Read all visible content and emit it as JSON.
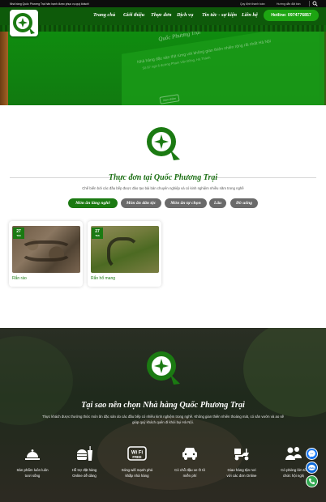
{
  "topbar": {
    "welcome": "Nhà hàng Quốc Phương Trại hân hạnh được phục vụ quý khách!",
    "links": [
      "Quy định thanh toán",
      "Hướng dẫn đặt bàn"
    ]
  },
  "nav": {
    "items": [
      "Trang chủ",
      "Giới thiệu",
      "Thực đơn",
      "Dịch vụ",
      "Tin tức - sự kiện",
      "Liên hệ"
    ],
    "hotline": "Hotline: 0974776857"
  },
  "hero": {
    "title": "Quốc Phương Trại",
    "text": "Nhà hàng đặc sản thịt rừng với không gian thiên nhiên rộng rãi nhất Hà Nội",
    "subtext": "Số 87 ngõ 6 đường Phạm Văn Đồng, Hà Thành",
    "button": "Xem thêm"
  },
  "menu_section": {
    "title": "Thực đơn tại Quốc Phương Trại",
    "description": "Chế biến bởi các đầu bếp được đào tạo bài bản chuyên nghiệp và có kinh nghiệm nhiều năm trong nghề",
    "tabs": [
      "Món ăn làng nghề",
      "Món ăn dân tộc",
      "Món ăn tự chọn",
      "Lẩu",
      "Đồ uống"
    ],
    "cards": [
      {
        "day": "27",
        "month": "Th6",
        "name": "Rắn ráo"
      },
      {
        "day": "27",
        "month": "Th6",
        "name": "Rắn hổ mang"
      }
    ]
  },
  "why_section": {
    "title": "Tại sao nên chọn Nhà hàng Quốc Phương Trại",
    "description_line1": "Thực khách được thưởng thức món ăn đặc sản do các đầu bếp có nhiều kinh nghiệm trong nghề. Không gian thiên nhiên thoáng mát, có sân vườn và ao sẽ",
    "description_line2": "giúp quý khách quên đi khói bụi Hà Nội.",
    "features": [
      {
        "icon": "chef-bell-icon",
        "line1": "Sản phẩm luôn luôn",
        "line2": "tươi sống"
      },
      {
        "icon": "burger-drink-icon",
        "line1": "Hỗ trợ đặt hàng",
        "line2": "Online dễ dàng"
      },
      {
        "icon": "wifi-free-icon",
        "line1": "Sóng wifi mạnh phủ",
        "line2": "khắp nhà hàng"
      },
      {
        "icon": "car-parking-icon",
        "line1": "Có chỗ đậu xe Ô tô",
        "line2": "miễn phí"
      },
      {
        "icon": "delivery-scooter-icon",
        "line1": "Giao hàng tận nơi",
        "line2": "với các đơn Online"
      },
      {
        "icon": "group-people-icon",
        "line1": "Có phòng lớn tổ",
        "line2": "chức hội nghị"
      }
    ]
  },
  "colors": {
    "brand_green": "#1b7a12",
    "nav_green": "#0e5a0a",
    "hotline": "#1da512"
  }
}
